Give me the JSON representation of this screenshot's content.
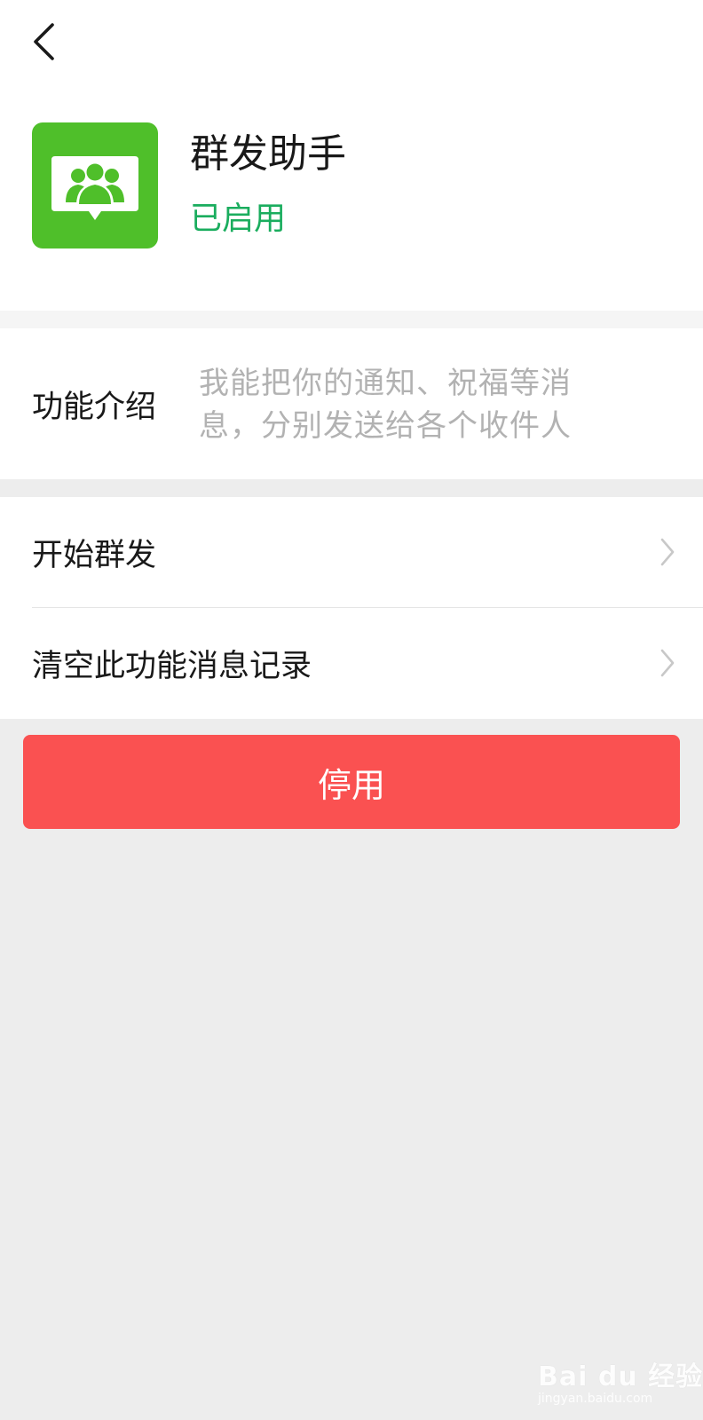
{
  "header": {
    "back_icon": "chevron-left-icon"
  },
  "app": {
    "icon": "group-broadcast-icon",
    "icon_color": "#4fbf2a",
    "title": "群发助手",
    "status": "已启用",
    "status_color": "#1aad5e"
  },
  "intro": {
    "label": "功能介绍",
    "text": "我能把你的通知、祝福等消息，分别发送给各个收件人"
  },
  "actions": [
    {
      "label": "开始群发",
      "icon": "chevron-right-icon"
    },
    {
      "label": "清空此功能消息记录",
      "icon": "chevron-right-icon"
    }
  ],
  "stop_button": {
    "label": "停用",
    "color": "#fa5151"
  },
  "watermark": {
    "brand": "Bai du 经验",
    "url": "jingyan.baidu.com"
  }
}
